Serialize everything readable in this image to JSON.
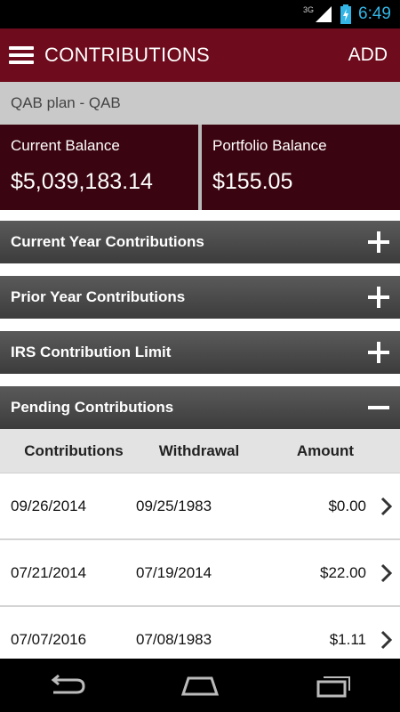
{
  "status_bar": {
    "network": "3G",
    "time": "6:49"
  },
  "app_bar": {
    "title": "CONTRIBUTIONS",
    "add_label": "ADD"
  },
  "plan": {
    "name": "QAB plan - QAB"
  },
  "balances": {
    "current": {
      "label": "Current Balance",
      "value": "$5,039,183.14"
    },
    "portfolio": {
      "label": "Portfolio Balance",
      "value": "$155.05"
    }
  },
  "sections": {
    "current_year": {
      "label": "Current Year Contributions",
      "state": "collapsed"
    },
    "prior_year": {
      "label": "Prior Year Contributions",
      "state": "collapsed"
    },
    "irs_limit": {
      "label": "IRS Contribution Limit",
      "state": "collapsed"
    },
    "pending": {
      "label": "Pending Contributions",
      "state": "expanded"
    }
  },
  "table": {
    "headers": {
      "contributions": "Contributions",
      "withdrawal": "Withdrawal",
      "amount": "Amount"
    },
    "rows": [
      {
        "contribution": "09/26/2014",
        "withdrawal": "09/25/1983",
        "amount": "$0.00"
      },
      {
        "contribution": "07/21/2014",
        "withdrawal": "07/19/2014",
        "amount": "$22.00"
      },
      {
        "contribution": "07/07/2016",
        "withdrawal": "07/08/1983",
        "amount": "$1.11"
      }
    ]
  },
  "colors": {
    "brand": "#6e0b1c",
    "balance_bg": "#3a0510",
    "clock": "#33b5e5"
  },
  "icons": {
    "menu": "hamburger-icon",
    "expand": "plus-icon",
    "collapse": "minus-icon",
    "row": "chevron-right-icon"
  }
}
